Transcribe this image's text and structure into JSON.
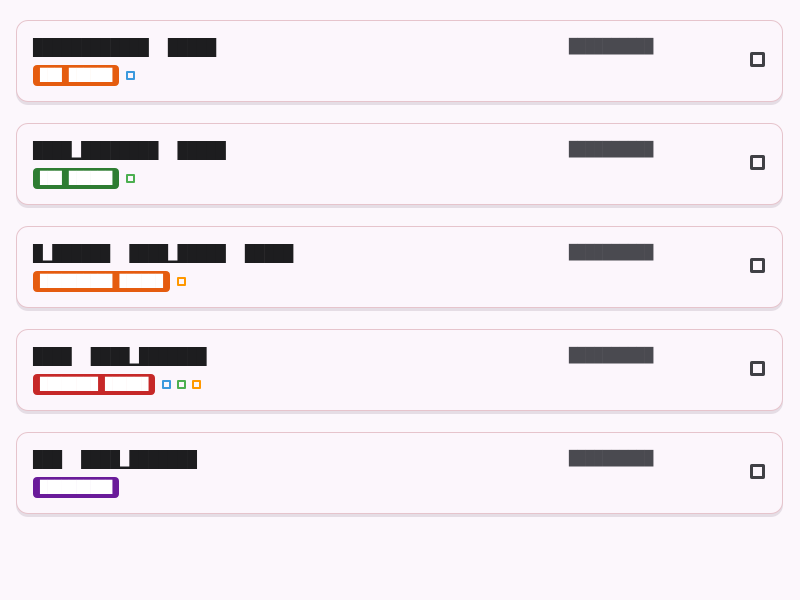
{
  "items": [
    {
      "title": "████████████  █████",
      "time": "██████████",
      "chip": "███ ██████",
      "chip_color": "#e55c0f",
      "dots": [
        "#3b99de"
      ]
    },
    {
      "title": "████▁████████  █████",
      "time": "██████████",
      "chip": "███ ██████",
      "chip_color": "#2e7d32",
      "dots": [
        "#4caf50"
      ]
    },
    {
      "title": "█▁██████  ████▁█████  █████",
      "time": "██████████",
      "chip": "██████████ ██████",
      "chip_color": "#e55c0f",
      "dots": [
        "#ff9800"
      ]
    },
    {
      "title": "████  ████▁███████",
      "time": "██████████",
      "chip": "████████ ██████",
      "chip_color": "#c62828",
      "dots": [
        "#3b99de",
        "#4caf50",
        "#ff9800"
      ]
    },
    {
      "title": "███  ████▁███████",
      "time": "██████████",
      "chip": "██████████",
      "chip_color": "#6a1b9a",
      "dots": []
    }
  ]
}
